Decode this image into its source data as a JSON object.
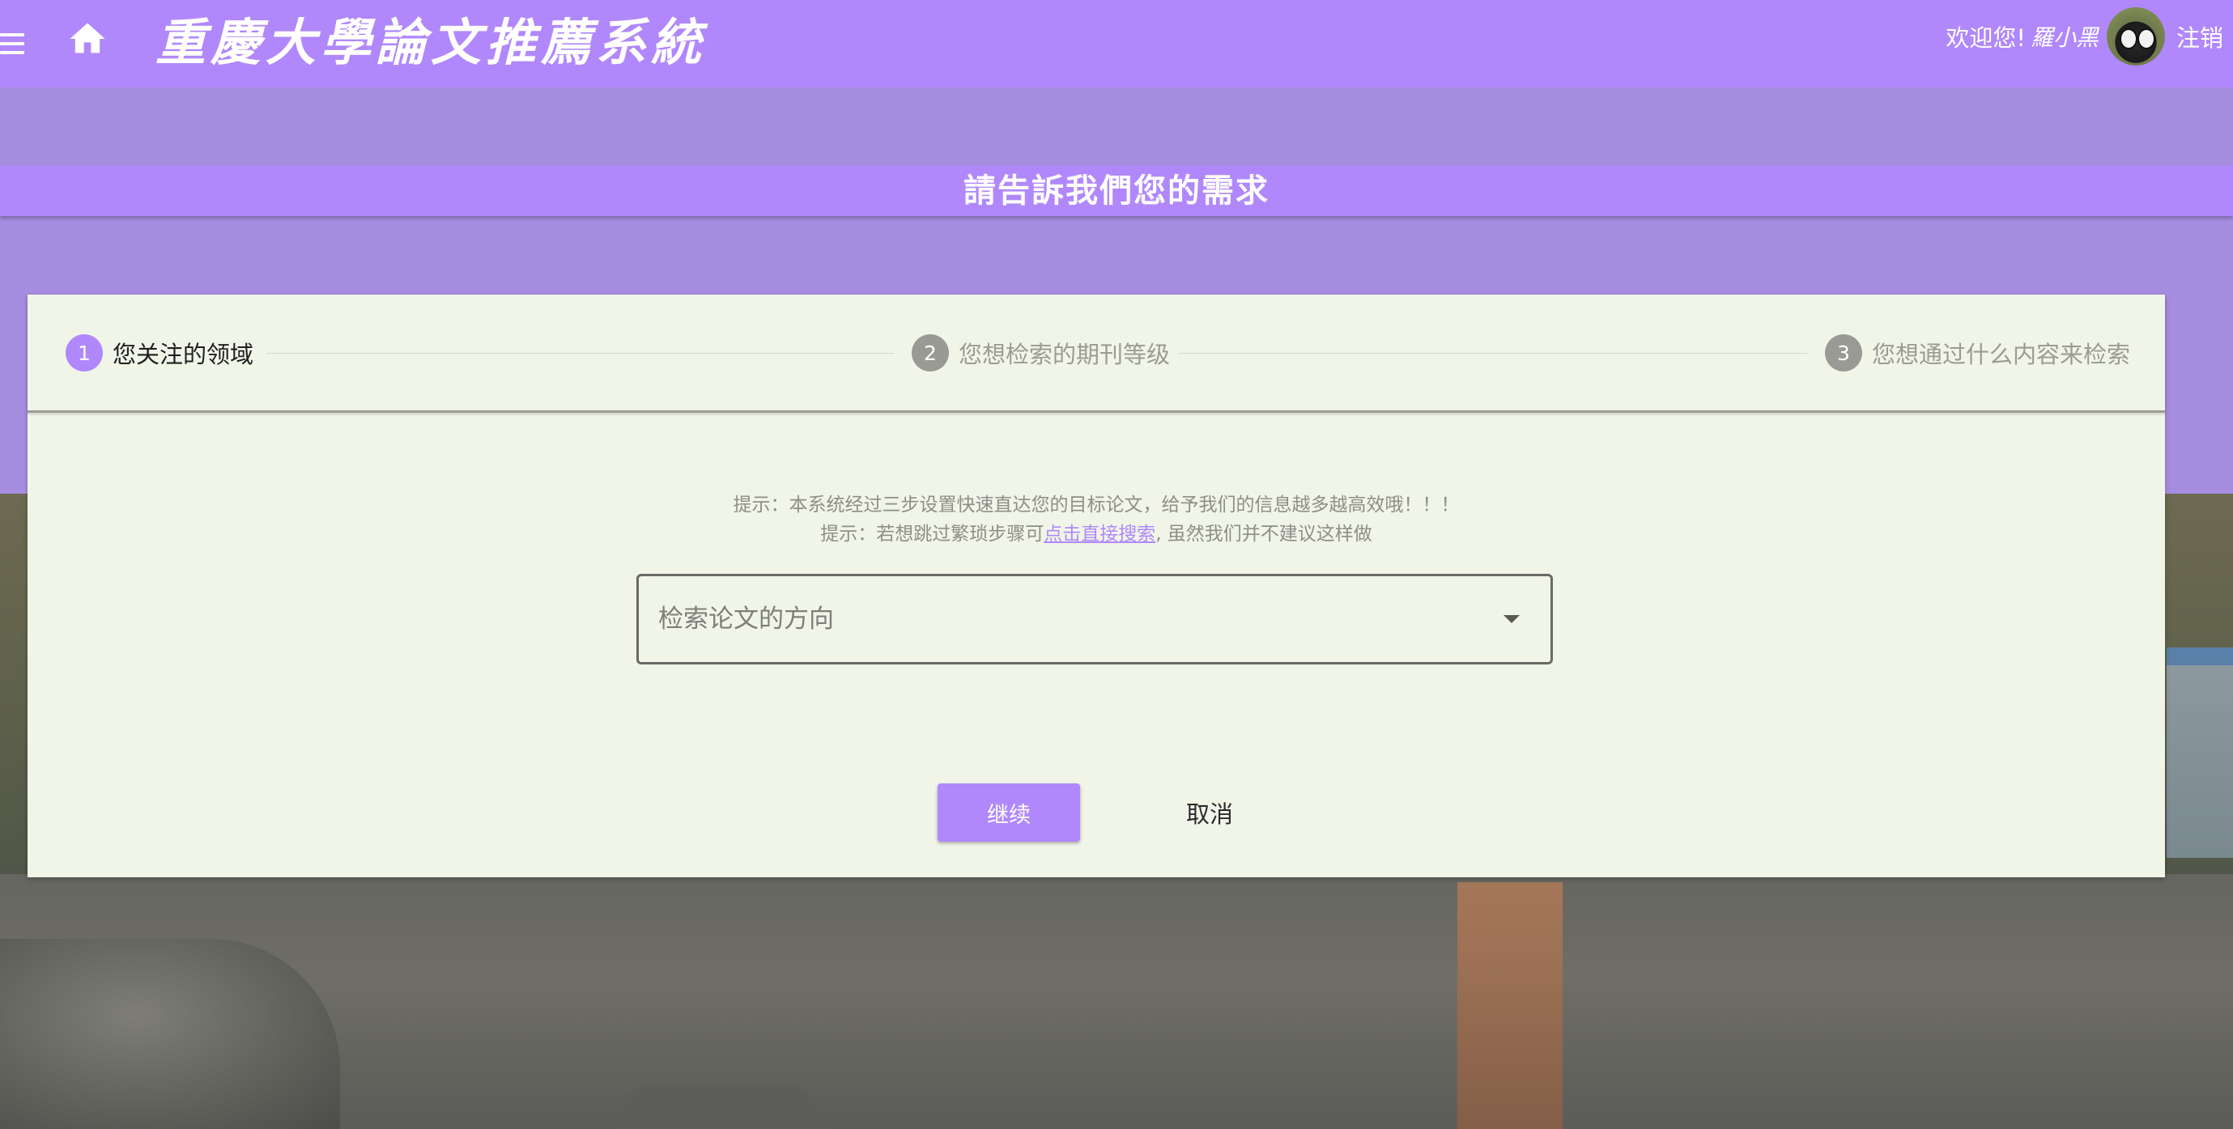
{
  "header": {
    "app_title": "重慶大學論文推薦系統",
    "welcome_text": "欢迎您!",
    "username": "羅小黑",
    "logout_label": "注销",
    "menu_icon": "menu-icon",
    "home_icon": "home-icon"
  },
  "section": {
    "title": "請告訴我們您的需求"
  },
  "stepper": {
    "steps": [
      {
        "number": "1",
        "label": "您关注的领域",
        "state": "active"
      },
      {
        "number": "2",
        "label": "您想检索的期刊等级",
        "state": "inactive"
      },
      {
        "number": "3",
        "label": "您想通过什么内容来检索",
        "state": "inactive"
      }
    ]
  },
  "hints": {
    "line1": "提示：本系统经过三步设置快速直达您的目标论文，给予我们的信息越多越高效哦！！！",
    "line2_prefix": "提示：若想跳过繁琐步骤可",
    "line2_link": "点击直接搜索",
    "line2_suffix": ", 虽然我们并不建议这样做"
  },
  "form": {
    "direction_select": {
      "placeholder": "检索论文的方向"
    }
  },
  "actions": {
    "continue_label": "继续",
    "cancel_label": "取消"
  },
  "colors": {
    "primary": "#b088fb",
    "card_background": "#f0f5e8",
    "inactive_step": "#9a9a94"
  }
}
